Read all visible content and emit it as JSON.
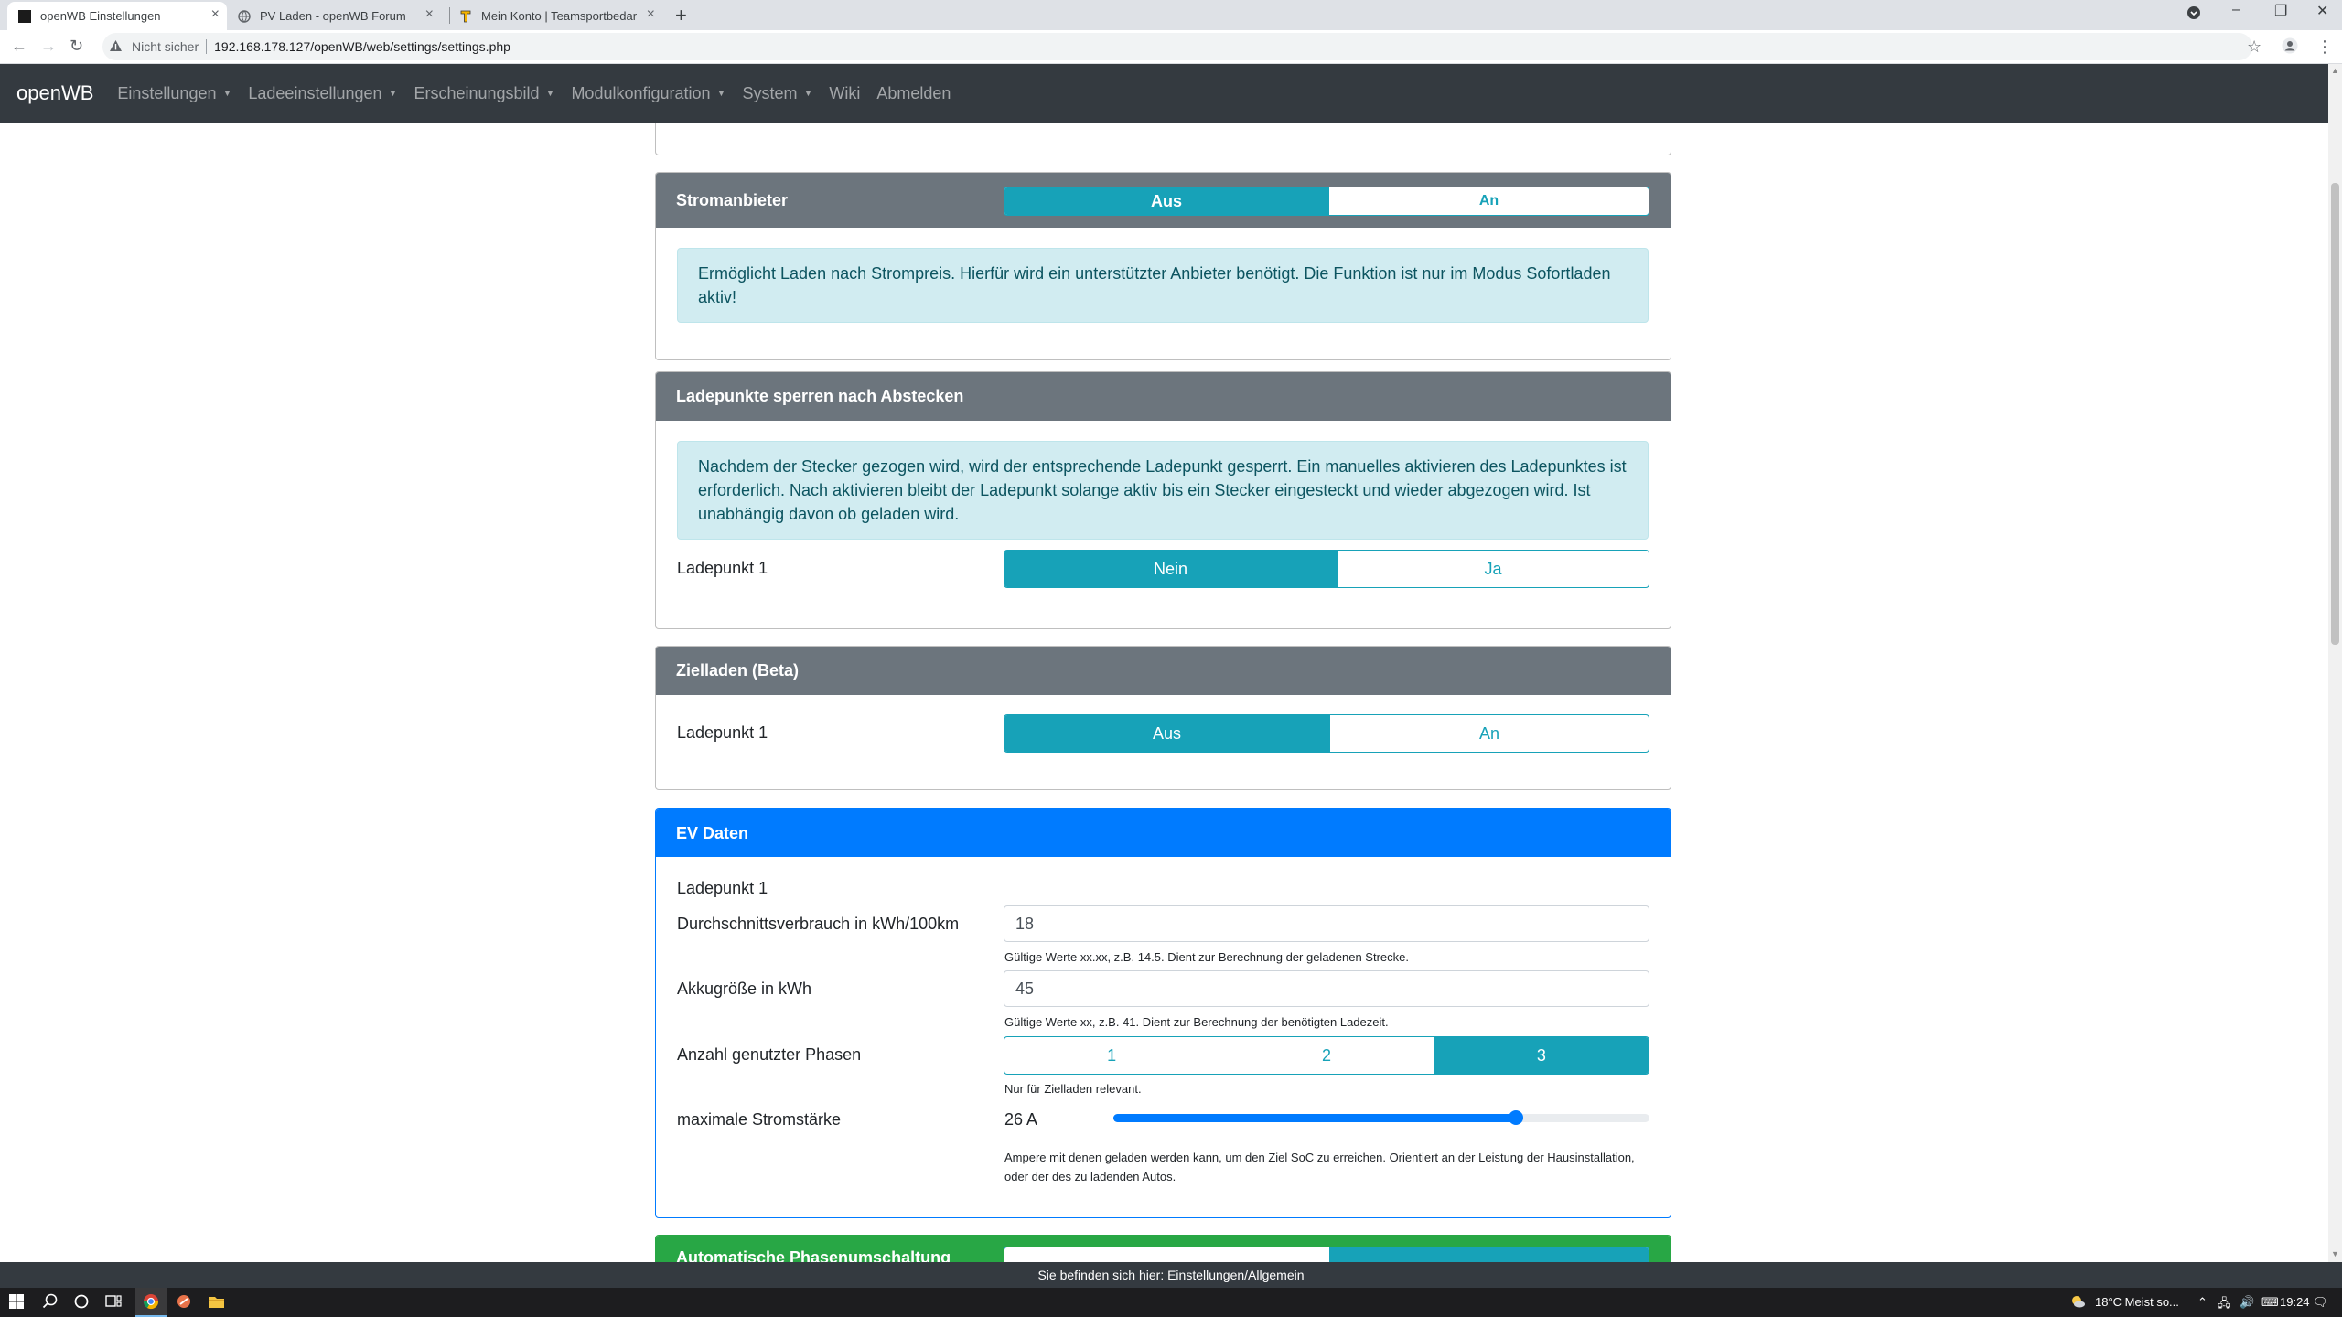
{
  "browser": {
    "tabs": [
      {
        "title": "openWB Einstellungen",
        "active": true
      },
      {
        "title": "PV Laden - openWB Forum",
        "active": false
      },
      {
        "title": "Mein Konto | Teamsportbedarf.de",
        "active": false
      }
    ],
    "security_label": "Nicht sicher",
    "url": "192.168.178.127/openWB/web/settings/settings.php"
  },
  "app": {
    "brand": "openWB",
    "nav": [
      {
        "label": "Einstellungen",
        "dropdown": true
      },
      {
        "label": "Ladeeinstellungen",
        "dropdown": true
      },
      {
        "label": "Erscheinungsbild",
        "dropdown": true
      },
      {
        "label": "Modulkonfiguration",
        "dropdown": true
      },
      {
        "label": "System",
        "dropdown": true
      },
      {
        "label": "Wiki",
        "dropdown": false
      },
      {
        "label": "Abmelden",
        "dropdown": false
      }
    ]
  },
  "stromanbieter": {
    "title": "Stromanbieter",
    "toggle": {
      "off": "Aus",
      "on": "An",
      "selected": "Aus"
    },
    "info": "Ermöglicht Laden nach Strompreis. Hierfür wird ein unterstützter Anbieter benötigt. Die Funktion ist nur im Modus Sofortladen aktiv!"
  },
  "sperren": {
    "title": "Ladepunkte sperren nach Abstecken",
    "info": "Nachdem der Stecker gezogen wird, wird der entsprechende Ladepunkt gesperrt. Ein manuelles aktivieren des Ladepunktes ist erforderlich. Nach aktivieren bleibt der Ladepunkt solange aktiv bis ein Stecker eingesteckt und wieder abgezogen wird. Ist unabhängig davon ob geladen wird.",
    "row_label": "Ladepunkt 1",
    "toggle": {
      "off": "Nein",
      "on": "Ja",
      "selected": "Nein"
    }
  },
  "zielladen": {
    "title": "Zielladen (Beta)",
    "row_label": "Ladepunkt 1",
    "toggle": {
      "off": "Aus",
      "on": "An",
      "selected": "Aus"
    }
  },
  "ev": {
    "title": "EV Daten",
    "subtitle": "Ladepunkt 1",
    "verbrauch": {
      "label": "Durchschnittsverbrauch in kWh/100km",
      "value": "18",
      "hint": "Gültige Werte xx.xx, z.B. 14.5. Dient zur Berechnung der geladenen Strecke."
    },
    "akku": {
      "label": "Akkugröße in kWh",
      "value": "45",
      "hint": "Gültige Werte xx, z.B. 41. Dient zur Berechnung der benötigten Ladezeit."
    },
    "phasen": {
      "label": "Anzahl genutzter Phasen",
      "options": [
        "1",
        "2",
        "3"
      ],
      "selected": "3",
      "hint": "Nur für Zielladen relevant."
    },
    "strom": {
      "label": "maximale Stromstärke",
      "value": "26 A",
      "level": 0.75,
      "hint": "Ampere mit denen geladen werden kann, um den Ziel SoC zu erreichen. Orientiert an der Leistung der Hausinstallation, oder der des zu ladenden Autos."
    }
  },
  "next_card": {
    "title": "Automatische Phasenumschaltung"
  },
  "footer": {
    "text": "Sie befinden sich hier: Einstellungen/Allgemein"
  },
  "taskbar": {
    "weather": "18°C  Meist so...",
    "time": "19:24"
  }
}
